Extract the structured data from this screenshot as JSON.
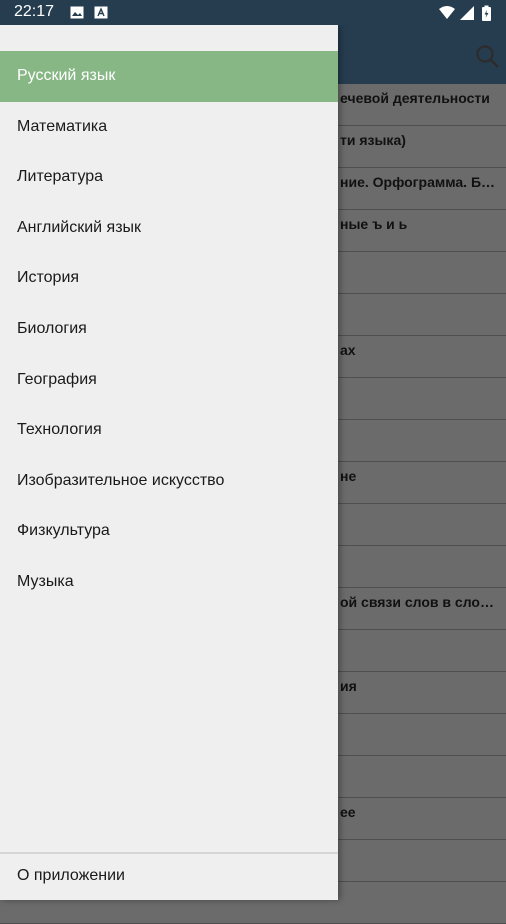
{
  "status_bar": {
    "time": "22:17",
    "icons": [
      "image-icon",
      "a-icon",
      "wifi-icon",
      "signal-icon",
      "battery-charging-icon"
    ]
  },
  "app_bar": {
    "search_icon": "search-icon"
  },
  "background_list": {
    "rows": [
      "ечевой деятельности",
      "ти языка)",
      "ние. Орфограмма. Б…",
      "ные ъ и ь",
      "",
      "",
      "ах",
      "",
      "",
      "не",
      "",
      "",
      "ой связи слов в сло…",
      "",
      "ия",
      "",
      "",
      "ее",
      "",
      ""
    ]
  },
  "drawer": {
    "items": [
      {
        "label": "Русский язык",
        "active": true
      },
      {
        "label": "Математика"
      },
      {
        "label": "Литература"
      },
      {
        "label": "Английский язык"
      },
      {
        "label": "История"
      },
      {
        "label": "Биология"
      },
      {
        "label": "География"
      },
      {
        "label": "Технология"
      },
      {
        "label": "Изобразительное искусство"
      },
      {
        "label": "Физкультура"
      },
      {
        "label": "Музыка"
      }
    ],
    "footer_label": "О приложении"
  },
  "colors": {
    "status_bar": "#263d4f",
    "active_item": "#86b784",
    "drawer_bg": "#efefef",
    "scrim": "#6b6b6b"
  }
}
